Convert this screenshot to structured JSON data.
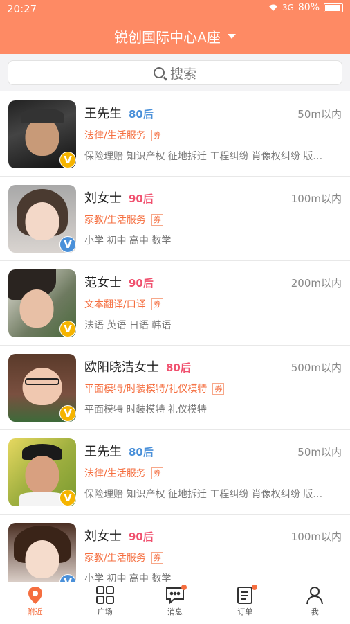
{
  "status_bar": {
    "time": "20:27",
    "signal": "3G",
    "battery": "80%"
  },
  "header": {
    "title": "锐创国际中心A座"
  },
  "search": {
    "placeholder": "搜索"
  },
  "list": [
    {
      "name": "王先生",
      "age": "80后",
      "age_color": "#4a90d9",
      "distance": "50m以内",
      "service": "法律/生活服务",
      "coupon": "券",
      "tags": "保险理赔 知识产权 征地拆迁 工程纠纷 肖像权纠纷 版…",
      "badge": "V",
      "badge_color": "#f5b400"
    },
    {
      "name": "刘女士",
      "age": "90后",
      "age_color": "#f0506e",
      "distance": "100m以内",
      "service": "家教/生活服务",
      "coupon": "券",
      "tags": "小学 初中 高中 数学",
      "badge": "V",
      "badge_color": "#4a90d9"
    },
    {
      "name": "范女士",
      "age": "90后",
      "age_color": "#f0506e",
      "distance": "200m以内",
      "service": "文本翻译/口译",
      "coupon": "券",
      "tags": "法语 英语 日语 韩语",
      "badge": "V",
      "badge_color": "#f5b400"
    },
    {
      "name": "欧阳晓洁女士",
      "age": "80后",
      "age_color": "#f0506e",
      "distance": "500m以内",
      "service": "平面模特/时装模特/礼仪模特",
      "coupon": "券",
      "tags": "平面模特 时装模特 礼仪模特",
      "badge": "V",
      "badge_color": "#f5b400"
    },
    {
      "name": "王先生",
      "age": "80后",
      "age_color": "#4a90d9",
      "distance": "50m以内",
      "service": "法律/生活服务",
      "coupon": "券",
      "tags": "保险理赔 知识产权 征地拆迁 工程纠纷 肖像权纠纷 版…",
      "badge": "V",
      "badge_color": "#f5b400"
    },
    {
      "name": "刘女士",
      "age": "90后",
      "age_color": "#f0506e",
      "distance": "100m以内",
      "service": "家教/生活服务",
      "coupon": "券",
      "tags": "小学 初中 高中 数学",
      "badge": "V",
      "badge_color": "#4a90d9"
    }
  ],
  "tabs": [
    {
      "label": "附近",
      "icon": "location-pin-icon"
    },
    {
      "label": "广场",
      "icon": "grid-icon"
    },
    {
      "label": "消息",
      "icon": "message-icon"
    },
    {
      "label": "订单",
      "icon": "order-list-icon"
    },
    {
      "label": "我",
      "icon": "person-icon"
    }
  ],
  "colors": {
    "accent": "#fe8a64",
    "service": "#f56e3f"
  }
}
